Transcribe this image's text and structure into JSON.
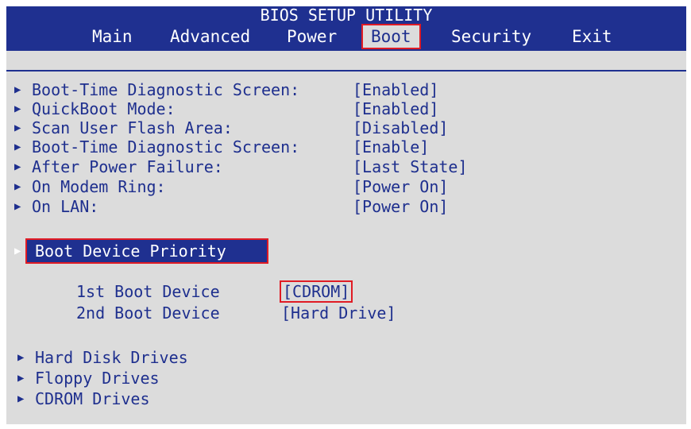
{
  "header": {
    "title": "BIOS SETUP UTILITY",
    "tabs": [
      "Main",
      "Advanced",
      "Power",
      "Boot",
      "Security",
      "Exit"
    ],
    "active_tab": "Boot"
  },
  "settings": [
    {
      "label": "Boot-Time Diagnostic Screen:",
      "value": "[Enabled]"
    },
    {
      "label": "QuickBoot Mode:",
      "value": "[Enabled]"
    },
    {
      "label": "Scan User Flash Area:",
      "value": "[Disabled]"
    },
    {
      "label": "Boot-Time Diagnostic Screen:",
      "value": "[Enable]"
    },
    {
      "label": "After Power Failure:",
      "value": "[Last State]"
    },
    {
      "label": "On Modem Ring:",
      "value": "[Power On]"
    },
    {
      "label": "On LAN:",
      "value": "[Power On]"
    }
  ],
  "boot_priority": {
    "label": "Boot Device Priority",
    "devices": [
      {
        "label": "1st Boot Device",
        "value": "[CDROM]"
      },
      {
        "label": "2nd Boot Device",
        "value": "[Hard Drive]"
      }
    ]
  },
  "drive_submenus": [
    "Hard Disk Drives",
    "Floppy Drives",
    "CDROM Drives"
  ],
  "colors": {
    "bios_blue": "#1f3090",
    "text_blue": "#1e2f8e",
    "background_gray": "#dcdcdc",
    "highlight_red": "#e01b24"
  },
  "icons": {
    "submenu_arrow": "triangle-right-icon"
  }
}
